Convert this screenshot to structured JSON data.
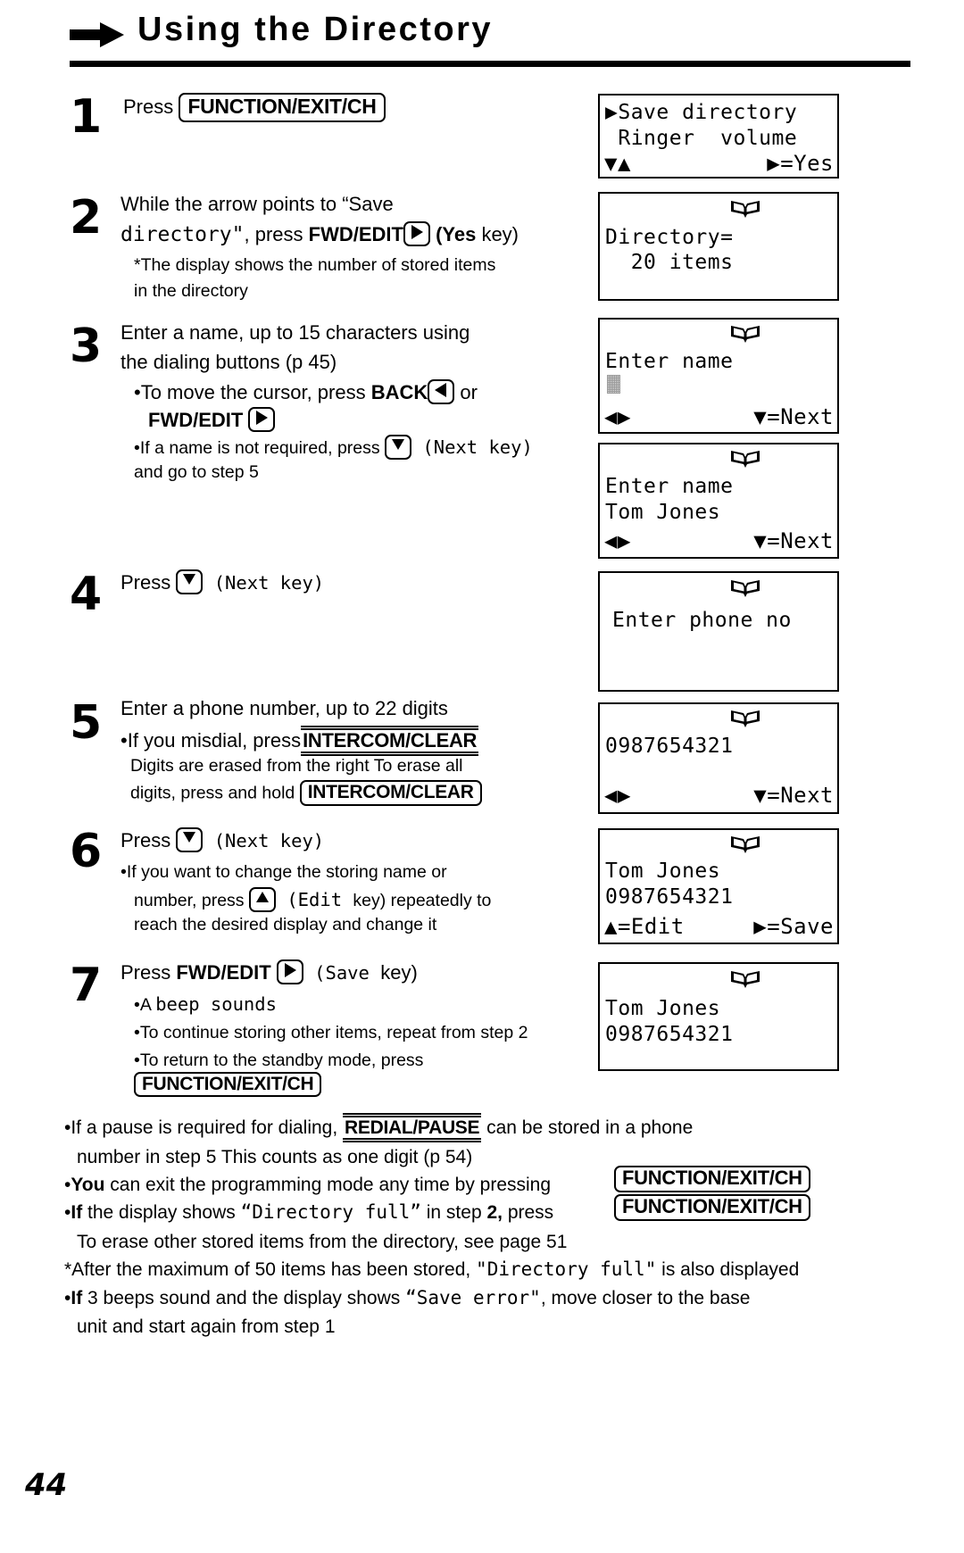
{
  "header": {
    "title": "Using the Directory",
    "arrow_icon": "right-arrow-icon"
  },
  "steps": [
    {
      "number": "1",
      "lines": [
        {
          "parts": [
            {
              "t": "text",
              "v": "Press "
            },
            {
              "t": "keybox",
              "v": "FUNCTION/EXIT/CH"
            }
          ]
        }
      ]
    },
    {
      "number": "2",
      "lines": [
        {
          "parts": [
            {
              "t": "text",
              "v": "While the arrow points to “Save"
            }
          ]
        },
        {
          "parts": [
            {
              "t": "mono",
              "v": "directory\""
            },
            {
              "t": "text",
              "v": ", press "
            },
            {
              "t": "bold",
              "v": "FWD/EDIT"
            },
            {
              "t": "arrowkey",
              "v": "right"
            },
            {
              "t": "bold",
              "v": " (Yes"
            },
            {
              "t": "text",
              "v": " key)"
            }
          ]
        },
        {
          "parts": [
            {
              "t": "small",
              "v": "*The display shows the number of stored items"
            }
          ]
        },
        {
          "parts": [
            {
              "t": "small",
              "v": "in the directory"
            }
          ]
        }
      ]
    },
    {
      "number": "3",
      "lines": [
        {
          "parts": [
            {
              "t": "text",
              "v": "Enter a name, up to 15 characters using"
            }
          ]
        },
        {
          "parts": [
            {
              "t": "text",
              "v": "the dialing buttons (p 45)"
            }
          ]
        },
        {
          "parts": [
            {
              "t": "text",
              "v": "•To move the cursor, press "
            },
            {
              "t": "bold",
              "v": "BACK"
            },
            {
              "t": "arrowkey",
              "v": "left"
            },
            {
              "t": "text",
              "v": " or"
            }
          ]
        },
        {
          "parts": [
            {
              "t": "bold",
              "v": "FWD/EDIT "
            },
            {
              "t": "arrowkey",
              "v": "right"
            }
          ]
        },
        {
          "parts": [
            {
              "t": "small",
              "v": "•If a name is not required, press  "
            },
            {
              "t": "arrowkey",
              "v": "down"
            },
            {
              "t": "mono",
              "v": "  (Next  key)"
            }
          ]
        },
        {
          "parts": [
            {
              "t": "small",
              "v": "and go to step 5"
            }
          ]
        }
      ]
    },
    {
      "number": "4",
      "lines": [
        {
          "parts": [
            {
              "t": "text",
              "v": "Press "
            },
            {
              "t": "arrowkey",
              "v": "down"
            },
            {
              "t": "mono",
              "v": "  (Next  key)"
            }
          ]
        }
      ]
    },
    {
      "number": "5",
      "lines": [
        {
          "parts": [
            {
              "t": "text",
              "v": "Enter a phone number, up to 22 digits"
            }
          ]
        },
        {
          "parts": [
            {
              "t": "text",
              "v": "•If you misdial, press"
            },
            {
              "t": "ulkey",
              "v": "INTERCOM/CLEAR"
            }
          ]
        },
        {
          "parts": [
            {
              "t": "small",
              "v": "Digits are erased from the right To erase all"
            }
          ]
        },
        {
          "parts": [
            {
              "t": "small",
              "v": "digits, press and  hold  "
            },
            {
              "t": "keybox",
              "v": "INTERCOM/CLEAR"
            }
          ]
        }
      ]
    },
    {
      "number": "6",
      "lines": [
        {
          "parts": [
            {
              "t": "text",
              "v": "Press "
            },
            {
              "t": "arrowkey",
              "v": "down"
            },
            {
              "t": "mono",
              "v": "  (Next  key)"
            }
          ]
        },
        {
          "parts": [
            {
              "t": "small",
              "v": "•If you want to change the storing name or"
            }
          ]
        },
        {
          "parts": [
            {
              "t": "small",
              "v": "number, press  "
            },
            {
              "t": "arrowkey",
              "v": "up"
            },
            {
              "t": "mono",
              "v": "  (Edit "
            },
            {
              "t": "small",
              "v": " key) repeatedly to"
            }
          ]
        },
        {
          "parts": [
            {
              "t": "small",
              "v": "reach the desired display and change it"
            }
          ]
        }
      ]
    },
    {
      "number": "7",
      "lines": [
        {
          "parts": [
            {
              "t": "text",
              "v": "Press "
            },
            {
              "t": "bold",
              "v": "FWD/EDIT "
            },
            {
              "t": "arrowkey",
              "v": "right"
            },
            {
              "t": "mono",
              "v": "  (Save "
            },
            {
              "t": "text",
              "v": " key)"
            }
          ]
        },
        {
          "parts": [
            {
              "t": "small",
              "v": "•A "
            },
            {
              "t": "mono",
              "v": "beep sounds"
            }
          ]
        },
        {
          "parts": [
            {
              "t": "small",
              "v": "•To continue storing other items, repeat from step 2"
            }
          ]
        },
        {
          "parts": [
            {
              "t": "small",
              "v": "•To return to the standby mode, press"
            }
          ]
        },
        {
          "parts": [
            {
              "t": "keybox",
              "v": "FUNCTION/EXIT/CH"
            }
          ]
        }
      ]
    }
  ],
  "displays": [
    {
      "id": "display-save-directory",
      "lines": [
        "▶Save directory",
        " Ringer  volume"
      ],
      "footer_left": "▼▲",
      "footer_right": "▶=Yes",
      "book_icon": false
    },
    {
      "id": "display-directory-count",
      "lines": [
        "Directory=",
        "  20 items"
      ],
      "footer_left": "",
      "footer_right": "",
      "book_icon": true
    },
    {
      "id": "display-enter-name-empty",
      "lines": [
        "Enter name",
        ""
      ],
      "footer_left": "◀▶",
      "footer_right": "▼=Next",
      "book_icon": true,
      "cursor": true
    },
    {
      "id": "display-enter-name-filled",
      "lines": [
        "Enter name",
        "Tom Jones"
      ],
      "footer_left": "◀▶",
      "footer_right": "▼=Next",
      "book_icon": true
    },
    {
      "id": "display-enter-phone-no",
      "lines": [
        "Enter phone no",
        ""
      ],
      "footer_left": "",
      "footer_right": "",
      "book_icon": true
    },
    {
      "id": "display-phone-number",
      "lines": [
        "0987654321",
        ""
      ],
      "footer_left": "◀▶",
      "footer_right": "▼=Next",
      "book_icon": true
    },
    {
      "id": "display-confirm-entry",
      "lines": [
        "Tom Jones",
        "0987654321"
      ],
      "footer_left": "▲=Edit",
      "footer_right": "▶=Save",
      "book_icon": true
    },
    {
      "id": "display-saved-entry",
      "lines": [
        "Tom Jones",
        "0987654321"
      ],
      "footer_left": "",
      "footer_right": "",
      "book_icon": true
    }
  ],
  "notes": [
    {
      "id": "note-pause",
      "lines": [
        {
          "parts": [
            {
              "t": "text",
              "v": "•If a pause is required for dialing, "
            },
            {
              "t": "ulkey",
              "v": "REDIAL/PAUSE"
            },
            {
              "t": "text",
              "v": " can be stored in a phone"
            }
          ]
        },
        {
          "parts": [
            {
              "t": "text",
              "v": "number in step 5 This counts as one digit (p 54)"
            }
          ]
        }
      ]
    },
    {
      "id": "note-exit-programming",
      "lines": [
        {
          "parts": [
            {
              "t": "text",
              "v": "•"
            },
            {
              "t": "bold",
              "v": "You"
            },
            {
              "t": "text",
              "v": " can exit the programming mode any time by pressing"
            }
          ]
        }
      ]
    },
    {
      "id": "note-directory-full",
      "lines": [
        {
          "parts": [
            {
              "t": "text",
              "v": "•"
            },
            {
              "t": "bold",
              "v": "If"
            },
            {
              "t": "text",
              "v": " the display shows  "
            },
            {
              "t": "mono",
              "v": "“Directory full”"
            },
            {
              "t": "text",
              "v": " in step "
            },
            {
              "t": "bold",
              "v": "2,"
            },
            {
              "t": "text",
              "v": " press"
            }
          ]
        },
        {
          "parts": [
            {
              "t": "text",
              "v": "To erase other stored items from the directory, see page 51"
            }
          ]
        }
      ]
    },
    {
      "id": "note-max-items",
      "lines": [
        {
          "parts": [
            {
              "t": "text",
              "v": "*After the maximum of 50 items has been stored,  "
            },
            {
              "t": "mono",
              "v": "\"Directory full\""
            },
            {
              "t": "text",
              "v": "  is also displayed"
            }
          ]
        }
      ]
    },
    {
      "id": "note-save-error",
      "lines": [
        {
          "parts": [
            {
              "t": "text",
              "v": "•"
            },
            {
              "t": "bold",
              "v": "If"
            },
            {
              "t": "text",
              "v": " 3 beeps sound and the display shows  "
            },
            {
              "t": "mono",
              "v": "“Save error\""
            },
            {
              "t": "text",
              "v": ",  move closer to the base"
            }
          ]
        },
        {
          "parts": [
            {
              "t": "text",
              "v": "unit and start again from step 1"
            }
          ]
        }
      ]
    }
  ],
  "note_keys": [
    {
      "id": "note-key-exit-1",
      "label": "FUNCTION/EXIT/CH"
    },
    {
      "id": "note-key-exit-2",
      "label": "FUNCTION/EXIT/CH"
    }
  ],
  "page_number": "44"
}
